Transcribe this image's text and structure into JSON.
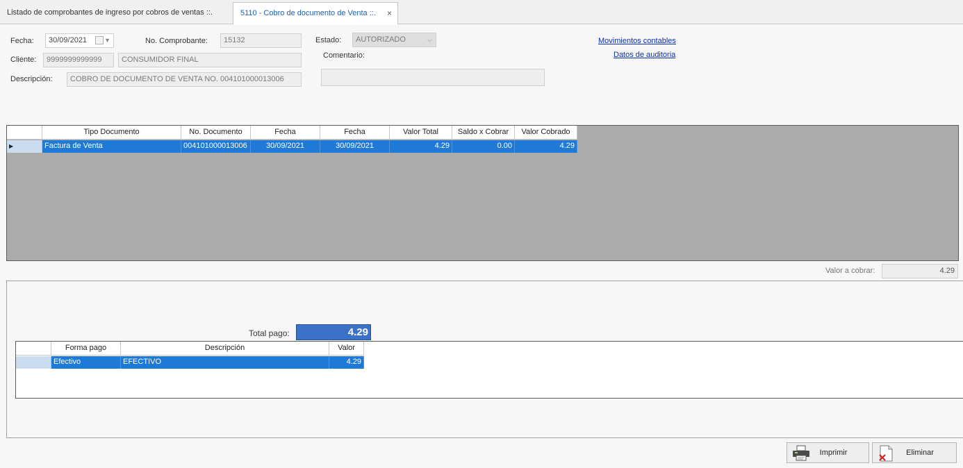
{
  "tabs": [
    {
      "label": "Listado de comprobantes de ingreso por cobros de ventas ::."
    },
    {
      "label": "5110 - Cobro de documento de Venta ::.",
      "close": "×"
    }
  ],
  "form": {
    "fecha_label": "Fecha:",
    "fecha_value": "30/09/2021",
    "comprobante_label": "No. Comprobante:",
    "comprobante_value": "15132",
    "estado_label": "Estado:",
    "estado_value": "AUTORIZADO",
    "cliente_label": "Cliente:",
    "cliente_id": "9999999999999",
    "cliente_name": "CONSUMIDOR FINAL",
    "comentario_label": "Comentario:",
    "comentario_value": "",
    "descripcion_label": "Descripción:",
    "descripcion_value": "COBRO DE DOCUMENTO DE VENTA NO. 004101000013006"
  },
  "links": {
    "movimientos": "Movimientos contables",
    "auditoria": "Datos de auditoria"
  },
  "documents_grid": {
    "headers": [
      "Tipo Documento",
      "No. Documento",
      "Fecha",
      "Fecha",
      "Valor Total",
      "Saldo x Cobrar",
      "Valor Cobrado"
    ],
    "rows": [
      {
        "indicator": "▶",
        "tipo": "Factura de Venta",
        "numero": "004101000013006",
        "fecha1": "30/09/2021",
        "fecha2": "30/09/2021",
        "valor_total": "4.29",
        "saldo": "0.00",
        "valor_cobrado": "4.29"
      }
    ]
  },
  "valor_cobrar": {
    "label": "Valor a cobrar:",
    "value": "4.29"
  },
  "total_pago": {
    "label": "Total pago:",
    "value": "4.29"
  },
  "payments_grid": {
    "headers": [
      "Forma pago",
      "Descripción",
      "Valor"
    ],
    "rows": [
      {
        "forma": "Efectivo",
        "descripcion": "EFECTIVO",
        "valor": "4.29"
      }
    ]
  },
  "buttons": {
    "imprimir": "Imprimir",
    "eliminar": "Eliminar"
  },
  "icons": {
    "printer": "printer-icon",
    "delete": "delete-icon",
    "calendar": "calendar-icon"
  },
  "colors": {
    "selection": "#1e7ad6",
    "grid_background": "#ababab",
    "total_box": "#3b72c8",
    "link": "#0a2fb0",
    "active_tab_text": "#1e5fae"
  }
}
